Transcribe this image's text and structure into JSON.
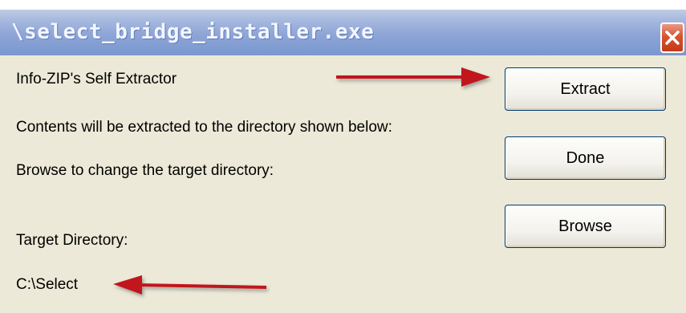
{
  "window": {
    "title": "\\select_bridge_installer.exe",
    "close_icon": "close-icon"
  },
  "content": {
    "heading": "Info-ZIP's Self Extractor",
    "info_line": "Contents will be extracted to the directory shown below:",
    "browse_hint": "Browse to change the target directory:",
    "target_label": "Target Directory:",
    "target_value": "C:\\Select"
  },
  "buttons": {
    "extract": "Extract",
    "done": "Done",
    "browse": "Browse"
  },
  "annotations": {
    "arrow_color": "#c0171a",
    "titlebar_color": "#8da5d6",
    "close_color": "#d6552f"
  }
}
